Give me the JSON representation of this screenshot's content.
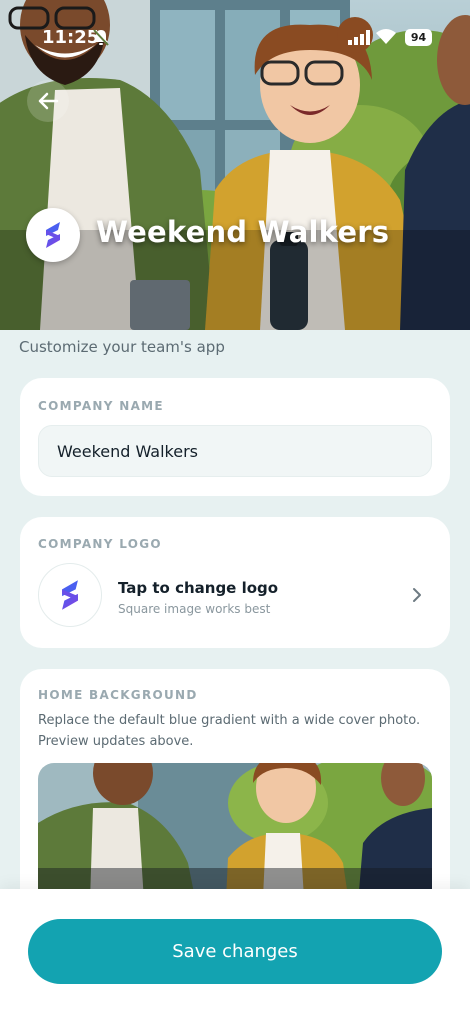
{
  "status_bar": {
    "time": "11:25",
    "battery": "94"
  },
  "hero": {
    "title": "Weekend Walkers"
  },
  "subtitle": "Customize your team's app",
  "company_name": {
    "label": "COMPANY NAME",
    "value": "Weekend Walkers"
  },
  "company_logo": {
    "label": "COMPANY LOGO",
    "title": "Tap to change logo",
    "hint": "Square image works best"
  },
  "home_background": {
    "label": "HOME BACKGROUND",
    "description": "Replace the default blue gradient with a wide cover photo. Preview updates above."
  },
  "footer": {
    "save_label": "Save changes"
  },
  "colors": {
    "accent": "#13a3b1",
    "logo_blue": "#4a5ff0",
    "logo_purple": "#8a3fe0",
    "page_bg": "#e7f1f1"
  },
  "icons": [
    "back-arrow-icon",
    "bell-off-icon",
    "signal-icon",
    "wifi-icon",
    "chevron-right-icon"
  ]
}
